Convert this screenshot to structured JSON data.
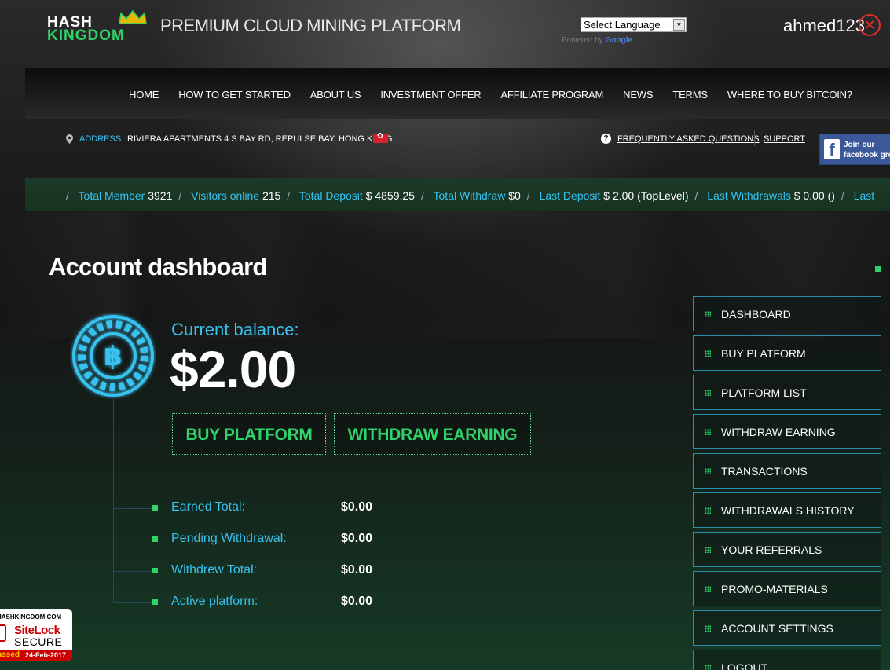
{
  "header": {
    "logo_top": "HASH",
    "logo_bottom": "KINGDOM",
    "tagline": "PREMIUM CLOUD MINING PLATFORM",
    "language_select": "Select Language",
    "powered_by": "Powered by",
    "powered_brand": "Google",
    "username": "ahmed123"
  },
  "nav": {
    "items": [
      "HOME",
      "HOW TO GET STARTED",
      "ABOUT US",
      "INVESTMENT OFFER",
      "AFFILIATE PROGRAM",
      "NEWS",
      "TERMS",
      "WHERE TO BUY BITCOIN?"
    ]
  },
  "info_bar": {
    "address_label": "ADDRESS :",
    "address_value": "RIVIERA APARTMENTS 4 S BAY RD, REPULSE BAY, HONG KONG.",
    "faq_link": "FREQUENTLY ASKED QUESTIONS",
    "support_link": "SUPPORT",
    "facebook_line1": "Join our",
    "facebook_line2": "facebook group"
  },
  "ticker": {
    "lead": "/",
    "items": [
      {
        "label": "Total Member",
        "value": "3921"
      },
      {
        "label": "Visitors online",
        "value": "215"
      },
      {
        "label": "Total Deposit",
        "value": "$ 4859.25"
      },
      {
        "label": "Total Withdraw",
        "value": "$0"
      },
      {
        "label": "Last Deposit",
        "value": "$ 2.00 (TopLevel)"
      },
      {
        "label": "Last Withdrawals",
        "value": "$ 0.00 ()"
      },
      {
        "label": "Last",
        "value": ""
      }
    ]
  },
  "dashboard": {
    "title": "Account dashboard",
    "balance_label": "Current balance:",
    "balance_value": "$2.00",
    "buy_button": "BUY PLATFORM",
    "withdraw_button": "WITHDRAW EARNING",
    "stats": [
      {
        "label": "Earned Total:",
        "value": "$0.00"
      },
      {
        "label": "Pending Withdrawal:",
        "value": "$0.00"
      },
      {
        "label": "Withdrew Total:",
        "value": "$0.00"
      },
      {
        "label": "Active platform:",
        "value": "$0.00"
      }
    ]
  },
  "sidebar": {
    "items": [
      "DASHBOARD",
      "BUY PLATFORM",
      "PLATFORM LIST",
      "WITHDRAW EARNING",
      "TRANSACTIONS",
      "WITHDRAWALS HISTORY",
      "YOUR REFERRALS",
      "PROMO-MATERIALS",
      "ACCOUNT SETTINGS",
      "LOGOUT"
    ]
  },
  "sitelock": {
    "domain": "HASHKINGDOM.COM",
    "brand_top": "SiteLock",
    "brand_bottom": "SECURE",
    "status": "Passed",
    "date": "24-Feb-2017"
  },
  "colors": {
    "accent_blue": "#37c2ef",
    "accent_green": "#2ed36a",
    "close_red": "#e0302b"
  }
}
